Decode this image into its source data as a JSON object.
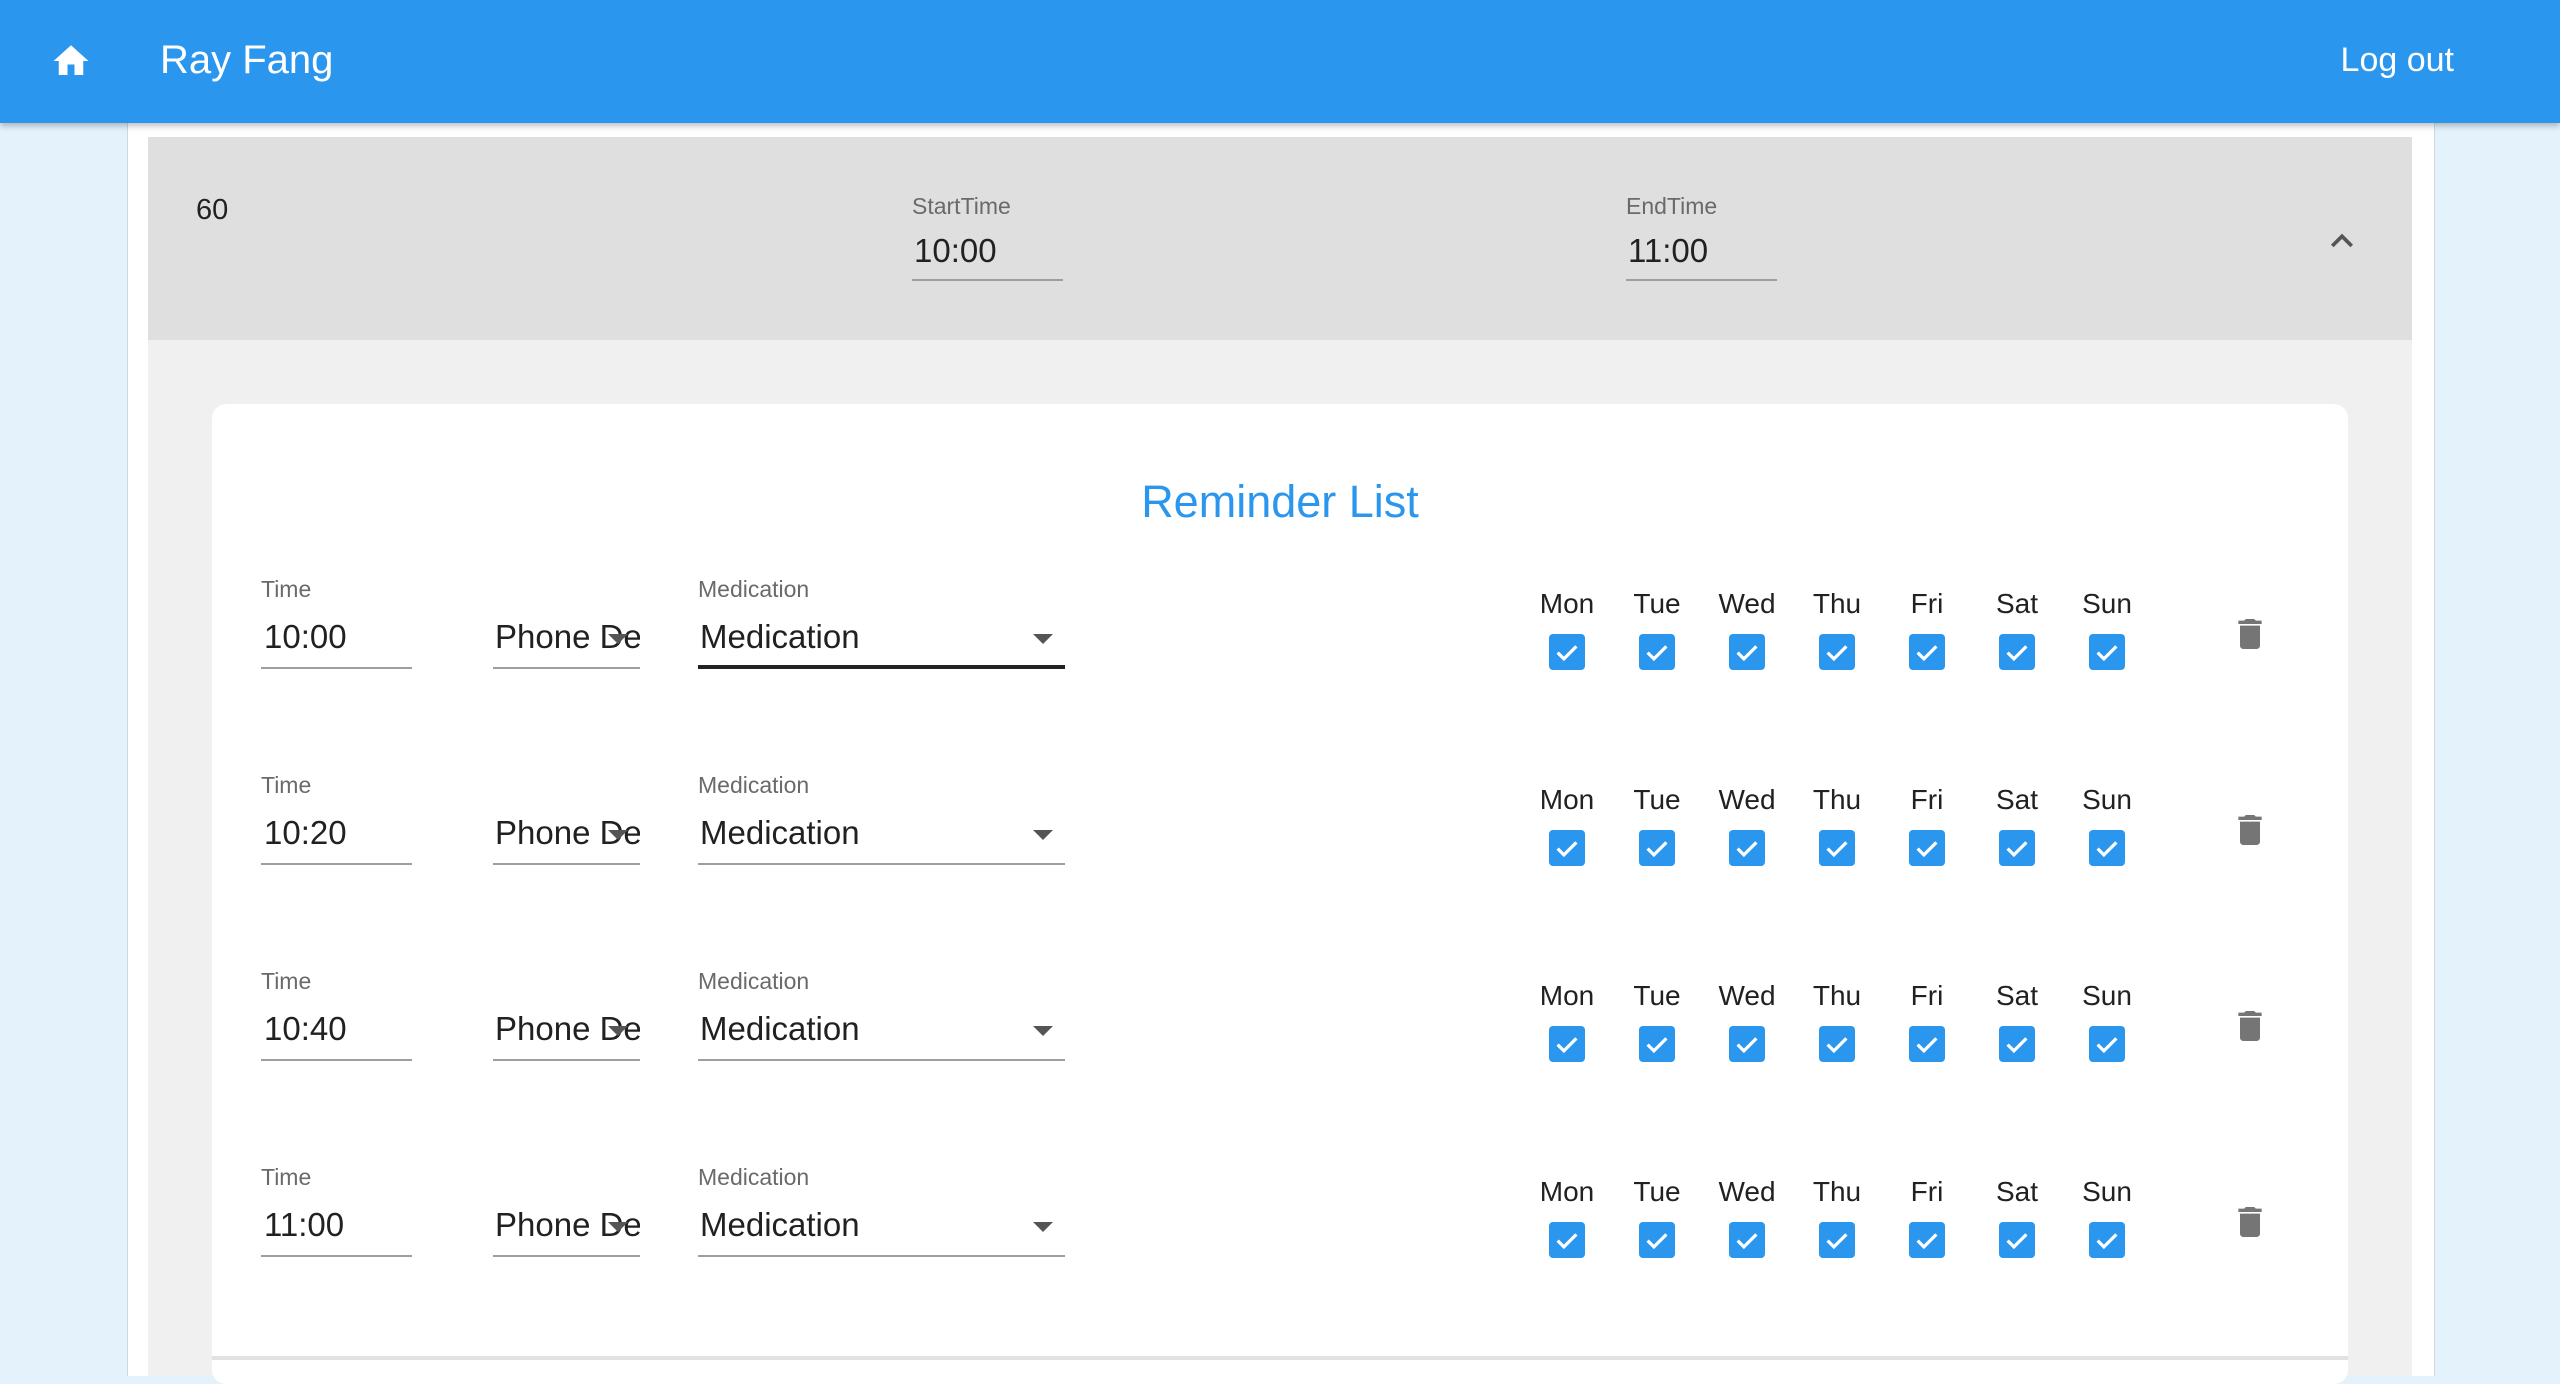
{
  "appbar": {
    "title": "Ray Fang",
    "logout_label": "Log out"
  },
  "schedule": {
    "interval": "60",
    "start_label": "StartTime",
    "start_value": "10:00",
    "end_label": "EndTime",
    "end_value": "11:00"
  },
  "reminder_list": {
    "title": "Reminder List",
    "rows": [
      {
        "time_label": "Time",
        "time": "10:00",
        "sound": "Phone Def…",
        "med_label": "Medication",
        "medication": "Medication"
      },
      {
        "time_label": "Time",
        "time": "10:20",
        "sound": "Phone Def…",
        "med_label": "Medication",
        "medication": "Medication"
      },
      {
        "time_label": "Time",
        "time": "10:40",
        "sound": "Phone Def…",
        "med_label": "Medication",
        "medication": "Medication"
      },
      {
        "time_label": "Time",
        "time": "11:00",
        "sound": "Phone Def…",
        "med_label": "Medication",
        "medication": "Medication"
      }
    ],
    "days": [
      "Mon",
      "Tue",
      "Wed",
      "Thu",
      "Fri",
      "Sat",
      "Sun"
    ]
  },
  "colors": {
    "primary": "#2b96ee",
    "panel_header": "#dfdfdf",
    "panel_body": "#f0f0f0",
    "background": "#e4f2fc"
  },
  "icons": {
    "home": "home-icon",
    "collapse": "chevron-up-icon",
    "delete": "trash-icon",
    "checkbox": "checkbox-checked-icon",
    "dropdown": "dropdown-arrow-icon"
  }
}
